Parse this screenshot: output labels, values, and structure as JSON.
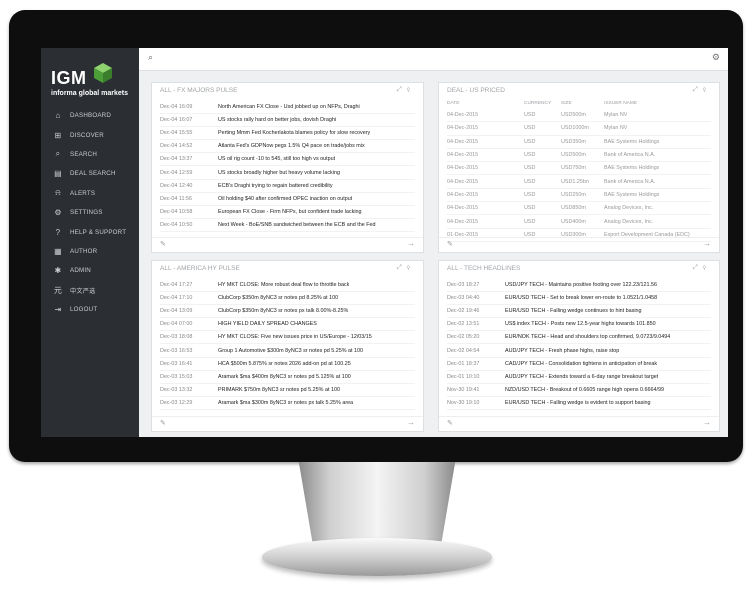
{
  "app": {
    "logo_text": "IGM",
    "tagline": "informa global markets"
  },
  "nav": [
    {
      "icon": "⌂",
      "label": "DASHBOARD",
      "icon_name": "home-icon"
    },
    {
      "icon": "⊞",
      "label": "DISCOVER",
      "icon_name": "grid-icon"
    },
    {
      "icon": "⌕",
      "label": "SEARCH",
      "icon_name": "search-icon"
    },
    {
      "icon": "▤",
      "label": "DEAL SEARCH",
      "icon_name": "deal-search-icon"
    },
    {
      "icon": "⍾",
      "label": "ALERTS",
      "icon_name": "bell-icon"
    },
    {
      "icon": "⚙",
      "label": "SETTINGS",
      "icon_name": "gear-icon"
    },
    {
      "icon": "?",
      "label": "HELP & SUPPORT",
      "icon_name": "help-icon"
    },
    {
      "icon": "▦",
      "label": "AUTHOR",
      "icon_name": "author-icon"
    },
    {
      "icon": "✱",
      "label": "ADMIN",
      "icon_name": "admin-icon"
    },
    {
      "icon": "元",
      "label": "中文严选",
      "icon_name": "chinese-icon"
    },
    {
      "icon": "⇥",
      "label": "LOGOUT",
      "icon_name": "logout-icon"
    }
  ],
  "panels": {
    "fx": {
      "title": "ALL - FX MAJORS PULSE",
      "rows": [
        {
          "ts": "Dec-04 16:09",
          "text": "North American FX Close - Usd jobbed up on NFPs, Draghi"
        },
        {
          "ts": "Dec-04 16:07",
          "text": "US stocks rally hard on better jobs, dovish Draghi"
        },
        {
          "ts": "Dec-04 15:55",
          "text": "Perting Mmm Fed Kocherlakota blames policy for slow recovery"
        },
        {
          "ts": "Dec-04 14:52",
          "text": "Atlanta Fed's GDPNow pegs 1.5% Q4 pace on trade/jobs mix"
        },
        {
          "ts": "Dec-04 13:37",
          "text": "US oil rig count -10 to 545, still too high vs output"
        },
        {
          "ts": "Dec-04 12:59",
          "text": "US stocks broadly higher but heavy volume lacking"
        },
        {
          "ts": "Dec-04 12:40",
          "text": "ECB's Draghi trying to regain battered credibility"
        },
        {
          "ts": "Dec-04 11:56",
          "text": "Oil holding $40 after confirmed OPEC inaction on output"
        },
        {
          "ts": "Dec-04 10:58",
          "text": "European FX Close - Firm NFPs, but confident trade lacking"
        },
        {
          "ts": "Dec-04 10:50",
          "text": "Next Week - BoE/SNB sandwiched between the ECB and the Fed"
        }
      ]
    },
    "deal": {
      "title": "DEAL - US PRICED",
      "headers": [
        "DATE",
        "CURRENCY",
        "SIZE",
        "ISSUER NAME"
      ],
      "rows": [
        {
          "date": "04-Dec-2015",
          "currency": "USD",
          "size": "USD500m",
          "issuer": "Mylan NV"
        },
        {
          "date": "04-Dec-2015",
          "currency": "USD",
          "size": "USD1000m",
          "issuer": "Mylan NV"
        },
        {
          "date": "04-Dec-2015",
          "currency": "USD",
          "size": "USD350m",
          "issuer": "BAE Systems Holdings"
        },
        {
          "date": "04-Dec-2015",
          "currency": "USD",
          "size": "USD500m",
          "issuer": "Bank of America N.A."
        },
        {
          "date": "04-Dec-2015",
          "currency": "USD",
          "size": "USD750m",
          "issuer": "BAE Systems Holdings"
        },
        {
          "date": "04-Dec-2015",
          "currency": "USD",
          "size": "USD1.25bn",
          "issuer": "Bank of America N.A."
        },
        {
          "date": "04-Dec-2015",
          "currency": "USD",
          "size": "USD250m",
          "issuer": "BAE Systems Holdings"
        },
        {
          "date": "04-Dec-2015",
          "currency": "USD",
          "size": "USD850m",
          "issuer": "Analog Devices, Inc."
        },
        {
          "date": "04-Dec-2015",
          "currency": "USD",
          "size": "USD400m",
          "issuer": "Analog Devices, Inc."
        },
        {
          "date": "01-Dec-2015",
          "currency": "USD",
          "size": "USD300m",
          "issuer": "Export Development Canada (EDC)"
        }
      ]
    },
    "hy": {
      "title": "ALL - AMERICA HY PULSE",
      "rows": [
        {
          "ts": "Dec-04 17:27",
          "text": "HY MKT CLOSE: More robust deal flow to throttle back"
        },
        {
          "ts": "Dec-04 17:10",
          "text": "ClubCorp $350m 8yNC3 sr notes pd 8.25% at 100"
        },
        {
          "ts": "Dec-04 13:09",
          "text": "ClubCorp $350m 8yNC3 sr notes px talk 8.00%-8.25%"
        },
        {
          "ts": "Dec-04 07:00",
          "text": "HIGH YIELD DAILY SPREAD CHANGES"
        },
        {
          "ts": "Dec-03 18:08",
          "text": "HY MKT CLOSE: Five new issues price in US/Europe - 12/03/15"
        },
        {
          "ts": "Dec-03 16:53",
          "text": "Group 1 Automotive $300m 8yNC3 sr notes pd 5.25% at 100"
        },
        {
          "ts": "Dec-03 16:41",
          "text": "HCA $500m 5.875% sr notes 2026 add-on pd at 100.25"
        },
        {
          "ts": "Dec-03 15:03",
          "text": "Aramark $ma $400m 8yNC3 sr notes pd 5.125% at 100"
        },
        {
          "ts": "Dec-03 13:32",
          "text": "PRIMARK $750m 8yNC3 sr notes pd 5.25% at 100"
        },
        {
          "ts": "Dec-03 12:29",
          "text": "Aramark $ma $300m 8yNC3 sr notes px talk 5.25% area"
        }
      ]
    },
    "tech": {
      "title": "ALL - TECH HEADLINES",
      "rows": [
        {
          "ts": "Dec-03 18:27",
          "text": "USD/JPY TECH - Maintains positive footing over 122.23/121.56"
        },
        {
          "ts": "Dec-03 04:40",
          "text": "EUR/USD TECH - Set to break lower en-route to 1.0521/1.0458"
        },
        {
          "ts": "Dec-02 19:46",
          "text": "EUR/USD TECH - Falling wedge continues to hint basing"
        },
        {
          "ts": "Dec-02 13:51",
          "text": "US$ index TECH - Posts new 12.5-year highs towards 101.850"
        },
        {
          "ts": "Dec-02 05:20",
          "text": "EUR/NOK TECH - Head and shoulders top confirmed, 9.0723/9.0494"
        },
        {
          "ts": "Dec-02 04:54",
          "text": "AUD/JPY TECH - Fresh phase highs, raise stop"
        },
        {
          "ts": "Dec-01 18:37",
          "text": "CAD/JPY TECH - Consolidation tightens in anticipation of break"
        },
        {
          "ts": "Dec-01 10:10",
          "text": "AUD/JPY TECH - Extends toward a 6-day range breakout target"
        },
        {
          "ts": "Nov-30 19:41",
          "text": "NZD/USD TECH - Breakout of 0.6605 range high opens 0.6664/99"
        },
        {
          "ts": "Nov-30 19:10",
          "text": "EUR/USD TECH - Falling wedge is evident to support basing"
        }
      ]
    }
  },
  "colors": {
    "sidebar": "#2b2e33",
    "logo_green": "#5bb543",
    "screen_bg": "#eef0f2"
  }
}
